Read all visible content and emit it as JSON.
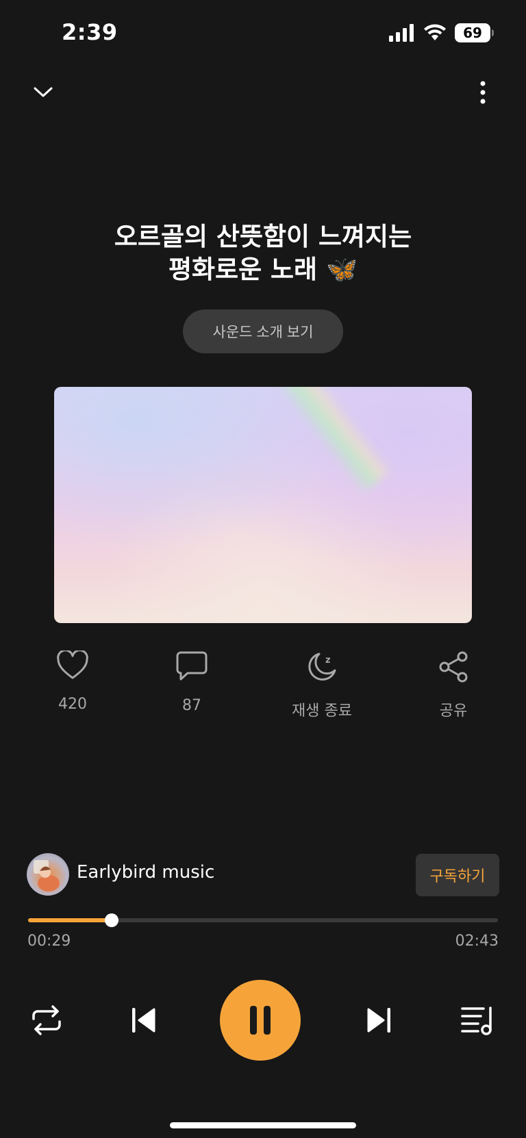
{
  "status_bar": {
    "time": "2:39",
    "battery": "69"
  },
  "nav": {
    "collapse_icon": "chevron-down-icon",
    "more_icon": "more-vertical-icon"
  },
  "track": {
    "title_line1": "오르골의 산뜻함이 느껴지는",
    "title_line2": "평화로운 노래",
    "title_emoji": "🦋",
    "intro_button": "사운드 소개 보기"
  },
  "actions": {
    "like": {
      "icon": "heart-icon",
      "label": "420"
    },
    "comment": {
      "icon": "comment-icon",
      "label": "87"
    },
    "sleep": {
      "icon": "moon-icon",
      "label": "재생 종료"
    },
    "share": {
      "icon": "share-icon",
      "label": "공유"
    }
  },
  "channel": {
    "name": "Earlybird music",
    "subscribe_label": "구독하기"
  },
  "player": {
    "elapsed": "00:29",
    "total": "02:43",
    "progress_fraction": 0.178,
    "state": "playing"
  },
  "colors": {
    "background": "#171717",
    "accent": "#f6a43a",
    "secondary_text": "#a8a8a8",
    "button_bg": "#3b3b3b"
  }
}
